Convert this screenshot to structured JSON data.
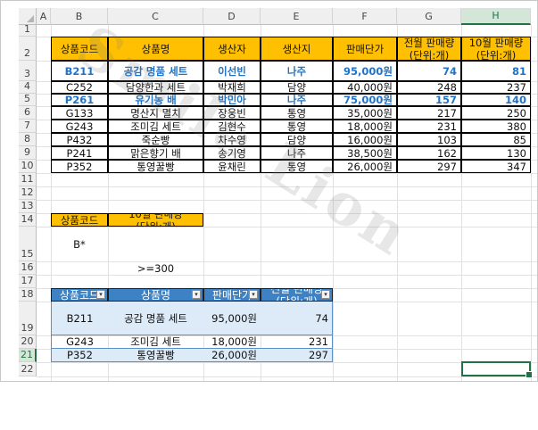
{
  "columns": [
    "A",
    "B",
    "C",
    "D",
    "E",
    "F",
    "G",
    "H"
  ],
  "selected_column": "H",
  "rows": [
    "1",
    "2",
    "3",
    "4",
    "5",
    "6",
    "7",
    "8",
    "9",
    "10",
    "11",
    "12",
    "13",
    "14",
    "15",
    "16",
    "17",
    "18",
    "19",
    "20",
    "21",
    "22"
  ],
  "selected_row": "21",
  "table1": {
    "headers": [
      "상품코드",
      "상품명",
      "생산자",
      "생산지",
      "판매단가",
      "전월 판매량\n(단위:개)",
      "10월 판매량\n(단위:개)"
    ],
    "rows": [
      {
        "code": "B211",
        "name": "공감 명품 세트",
        "producer": "이선빈",
        "origin": "나주",
        "price": "95,000원",
        "prev": "74",
        "oct": "81",
        "highlight": true
      },
      {
        "code": "C252",
        "name": "담양한과 세트",
        "producer": "박재희",
        "origin": "담양",
        "price": "40,000원",
        "prev": "248",
        "oct": "237",
        "highlight": false
      },
      {
        "code": "P261",
        "name": "유기농 배",
        "producer": "박민아",
        "origin": "나주",
        "price": "75,000원",
        "prev": "157",
        "oct": "140",
        "highlight": true
      },
      {
        "code": "G133",
        "name": "명산지 멸치",
        "producer": "장웅빈",
        "origin": "통영",
        "price": "35,000원",
        "prev": "217",
        "oct": "250",
        "highlight": false
      },
      {
        "code": "G243",
        "name": "조미김 세트",
        "producer": "김현수",
        "origin": "통영",
        "price": "18,000원",
        "prev": "231",
        "oct": "380",
        "highlight": false
      },
      {
        "code": "P432",
        "name": "죽순빵",
        "producer": "차수영",
        "origin": "담양",
        "price": "16,000원",
        "prev": "103",
        "oct": "85",
        "highlight": false
      },
      {
        "code": "P241",
        "name": "맑은향기 배",
        "producer": "송기영",
        "origin": "나주",
        "price": "38,500원",
        "prev": "162",
        "oct": "130",
        "highlight": false
      },
      {
        "code": "P352",
        "name": "통영꿀빵",
        "producer": "윤채린",
        "origin": "통영",
        "price": "26,000원",
        "prev": "297",
        "oct": "347",
        "highlight": false
      }
    ]
  },
  "criteria": {
    "header1": "상품코드",
    "header2": "10월 판매량\n(단위:개)",
    "value1": "B*",
    "value2": ">=300"
  },
  "table2": {
    "headers": [
      "상품코드",
      "상품명",
      "판매단가",
      "전월 판매량\n(단위:개)"
    ],
    "rows": [
      {
        "code": "B211",
        "name": "공감 명품 세트",
        "price": "95,000원",
        "prev": "74"
      },
      {
        "code": "G243",
        "name": "조미김 세트",
        "price": "18,000원",
        "prev": "231"
      },
      {
        "code": "P352",
        "name": "통영꿀빵",
        "price": "26,000원",
        "prev": "297"
      }
    ],
    "dropdown_icon": "filter-dropdown-icon"
  },
  "watermark": "Smile Lion",
  "colors": {
    "header_orange": "#fec000",
    "highlight_blue": "#1f73c8",
    "table_header_blue": "#3d82c4",
    "table_band": "#ddeaf7",
    "selection_green": "#217346"
  }
}
